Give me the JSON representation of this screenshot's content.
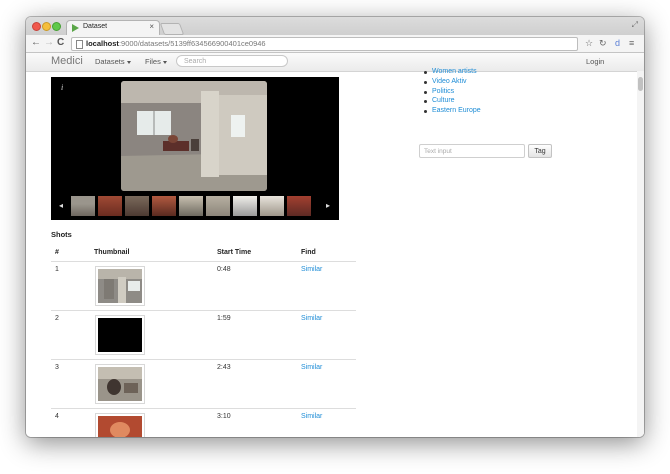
{
  "browser": {
    "tab_title": "Dataset",
    "tab_close": "×",
    "url_host": "localhost",
    "url_path": ":9000/datasets/5139ff634566900401ce0946",
    "icons": [
      "back-icon",
      "forward-icon",
      "reload-icon",
      "star-icon",
      "extension-icon",
      "menu-icon"
    ]
  },
  "navbar": {
    "brand": "Medici",
    "datasets": "Datasets",
    "files": "Files",
    "search_placeholder": "Search",
    "login": "Login"
  },
  "viewer": {
    "info": "i",
    "prev": "◂",
    "next": "▸"
  },
  "shots": {
    "heading": "Shots",
    "columns": [
      "#",
      "Thumbnail",
      "Start Time",
      "Find"
    ],
    "rows": [
      {
        "num": "1",
        "start": "0:48",
        "find": "Similar"
      },
      {
        "num": "2",
        "start": "1:59",
        "find": "Similar"
      },
      {
        "num": "3",
        "start": "2:43",
        "find": "Similar"
      },
      {
        "num": "4",
        "start": "3:10",
        "find": "Similar"
      }
    ]
  },
  "tags": {
    "items": [
      "Women artists",
      "Video Aktiv",
      "Politics",
      "Culture",
      "Eastern Europe"
    ],
    "input_placeholder": "Text input",
    "button": "Tag"
  },
  "colors": {
    "link": "#1f8dd6",
    "viewer_bg": "#000000"
  }
}
